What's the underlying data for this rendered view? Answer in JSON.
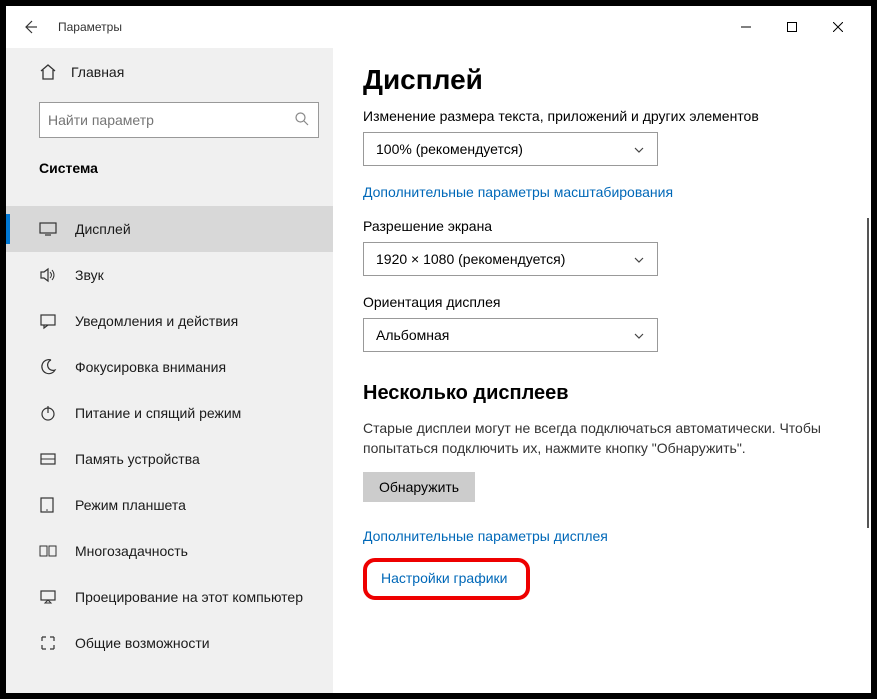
{
  "window": {
    "title": "Параметры"
  },
  "sidebar": {
    "home": "Главная",
    "search_placeholder": "Найти параметр",
    "section": "Система",
    "items": [
      {
        "label": "Дисплей"
      },
      {
        "label": "Звук"
      },
      {
        "label": "Уведомления и действия"
      },
      {
        "label": "Фокусировка внимания"
      },
      {
        "label": "Питание и спящий режим"
      },
      {
        "label": "Память устройства"
      },
      {
        "label": "Режим планшета"
      },
      {
        "label": "Многозадачность"
      },
      {
        "label": "Проецирование на этот компьютер"
      },
      {
        "label": "Общие возможности"
      }
    ]
  },
  "main": {
    "heading": "Дисплей",
    "scale_label": "Изменение размера текста, приложений и других элементов",
    "scale_value": "100% (рекомендуется)",
    "advanced_scaling_link": "Дополнительные параметры масштабирования",
    "resolution_label": "Разрешение экрана",
    "resolution_value": "1920 × 1080 (рекомендуется)",
    "orientation_label": "Ориентация дисплея",
    "orientation_value": "Альбомная",
    "multi_heading": "Несколько дисплеев",
    "multi_para": "Старые дисплеи могут не всегда подключаться автоматически. Чтобы попытаться подключить их, нажмите кнопку \"Обнаружить\".",
    "detect_button": "Обнаружить",
    "advanced_display_link": "Дополнительные параметры дисплея",
    "graphics_link": "Настройки графики"
  }
}
